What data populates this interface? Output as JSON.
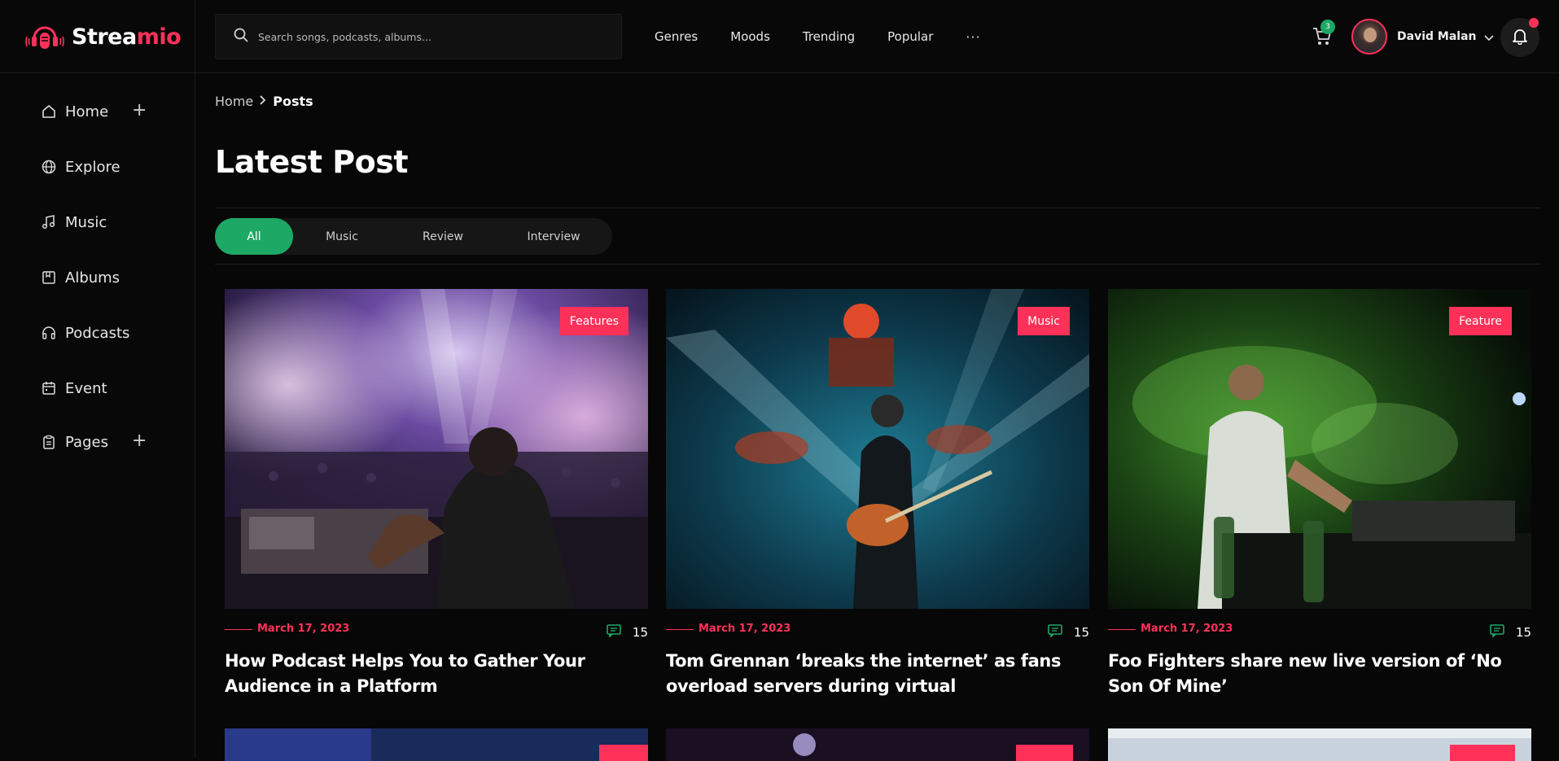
{
  "app": {
    "logo_part1": "Strea",
    "logo_part2": "mio",
    "brand_color": "#ff3159",
    "accent_green": "#1ea865"
  },
  "search": {
    "placeholder": "Search songs, podcasts, albums..."
  },
  "topnav": {
    "items": [
      "Genres",
      "Moods",
      "Trending",
      "Popular"
    ],
    "more": "···"
  },
  "cart": {
    "count": "3"
  },
  "user": {
    "name": "David Malan"
  },
  "sidebar": {
    "items": [
      {
        "label": "Home",
        "icon": "home-icon",
        "expandable": true
      },
      {
        "label": "Explore",
        "icon": "globe-icon",
        "expandable": false
      },
      {
        "label": "Music",
        "icon": "music-note-icon",
        "expandable": false
      },
      {
        "label": "Albums",
        "icon": "album-icon",
        "expandable": false
      },
      {
        "label": "Podcasts",
        "icon": "headphones-icon",
        "expandable": false
      },
      {
        "label": "Event",
        "icon": "calendar-icon",
        "expandable": false
      },
      {
        "label": "Pages",
        "icon": "clipboard-icon",
        "expandable": true
      }
    ]
  },
  "breadcrumb": {
    "home": "Home",
    "current": "Posts"
  },
  "page": {
    "title": "Latest Post"
  },
  "filters": {
    "tabs": [
      "All",
      "Music",
      "Review",
      "Interview"
    ],
    "active": "All"
  },
  "posts": [
    {
      "badge": "Features",
      "date": "March 17, 2023",
      "comments": "15",
      "title": "How Podcast Helps You to Gather Your Audience in a Platform",
      "image": "dj-crowd-purple-smoke"
    },
    {
      "badge": "Music",
      "date": "March 17, 2023",
      "comments": "15",
      "title": "Tom Grennan ‘breaks the internet’ as fans overload servers during virtual",
      "image": "guitarist-blue-stage"
    },
    {
      "badge": "Feature",
      "date": "March 17, 2023",
      "comments": "15",
      "title": "Foo Fighters share new live version of ‘No Son Of Mine’",
      "image": "dj-green-smoke"
    }
  ]
}
